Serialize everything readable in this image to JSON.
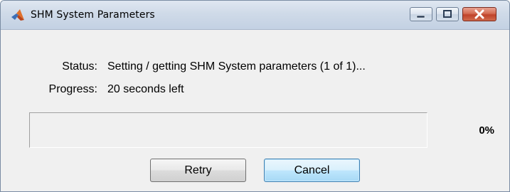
{
  "window": {
    "title": "SHM System Parameters",
    "app_icon": "matlab-icon"
  },
  "titlebar_buttons": {
    "minimize_icon": "minimize-icon",
    "maximize_icon": "maximize-icon",
    "close_icon": "close-icon"
  },
  "status": {
    "label": "Status:",
    "value": "Setting / getting SHM System parameters (1 of 1)..."
  },
  "progress": {
    "label": "Progress:",
    "value": "20 seconds left",
    "fraction": 0,
    "percent_text": "0%",
    "fill_color": "#4a7fcf"
  },
  "buttons": {
    "retry_label": "Retry",
    "cancel_label": "Cancel"
  },
  "colors": {
    "close_button": "#c0432a",
    "default_button_accent": "#3c7fb1"
  }
}
